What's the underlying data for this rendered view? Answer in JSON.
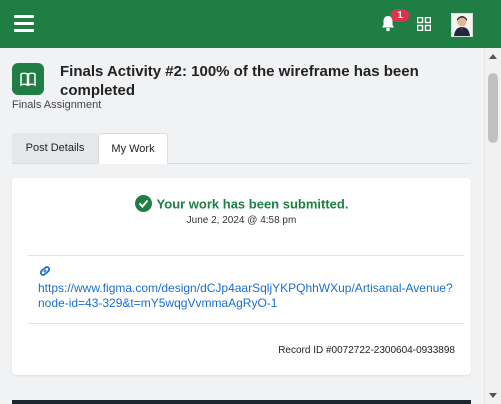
{
  "topbar": {
    "menu_icon": "hamburger-icon",
    "notification_icon": "bell-icon",
    "notification_count": "1",
    "apps_icon": "grid-icon",
    "brand_color": "#1e7e43"
  },
  "activity": {
    "icon": "book-icon",
    "title": "Finals Activity #2: 100% of the wireframe has been completed",
    "subtitle": "Finals Assignment"
  },
  "tabs": [
    {
      "label": "Post Details",
      "active": false
    },
    {
      "label": "My Work",
      "active": true
    }
  ],
  "submission": {
    "status": "Your work has been submitted.",
    "date": "June 2, 2024 @ 4:58 pm",
    "link_icon": "link-icon",
    "link": "https://www.figma.com/design/dCJp4aarSqljYKPQhhWXup/Artisanal-Avenue?node-id=43-329&t=mY5wqgVvmmaAgRyO-1",
    "record_id": "Record ID #0072722-2300604-0933898",
    "status_color": "#1e7e43"
  }
}
